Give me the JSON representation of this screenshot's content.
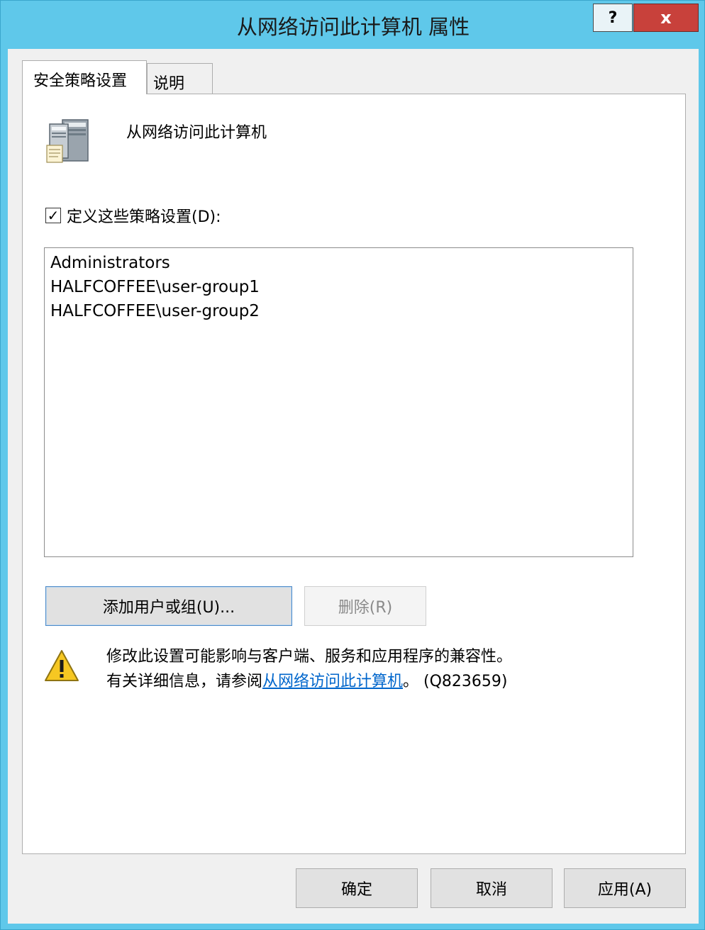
{
  "window": {
    "title": "从网络访问此计算机 属性",
    "help_label": "?",
    "close_label": "x"
  },
  "tabs": [
    {
      "label": "安全策略设置",
      "active": true
    },
    {
      "label": "说明",
      "active": false
    }
  ],
  "policy": {
    "name": "从网络访问此计算机",
    "icon": "server-icon"
  },
  "define_setting": {
    "label": "定义这些策略设置(D):",
    "checked": true
  },
  "principals": [
    "Administrators",
    "HALFCOFFEE\\user-group1",
    "HALFCOFFEE\\user-group2"
  ],
  "buttons": {
    "add": "添加用户或组(U)...",
    "remove": "删除(R)",
    "ok": "确定",
    "cancel": "取消",
    "apply": "应用(A)"
  },
  "warning": {
    "icon": "warning-icon",
    "line1": "修改此设置可能影响与客户端、服务和应用程序的兼容性。",
    "line2_prefix": "有关详细信息，请参阅",
    "link_text": "从网络访问此计算机",
    "line2_suffix": "。 (Q823659)"
  },
  "colors": {
    "title_bar": "#5fc8ea",
    "close_button": "#c8413b",
    "link": "#0066cc"
  }
}
